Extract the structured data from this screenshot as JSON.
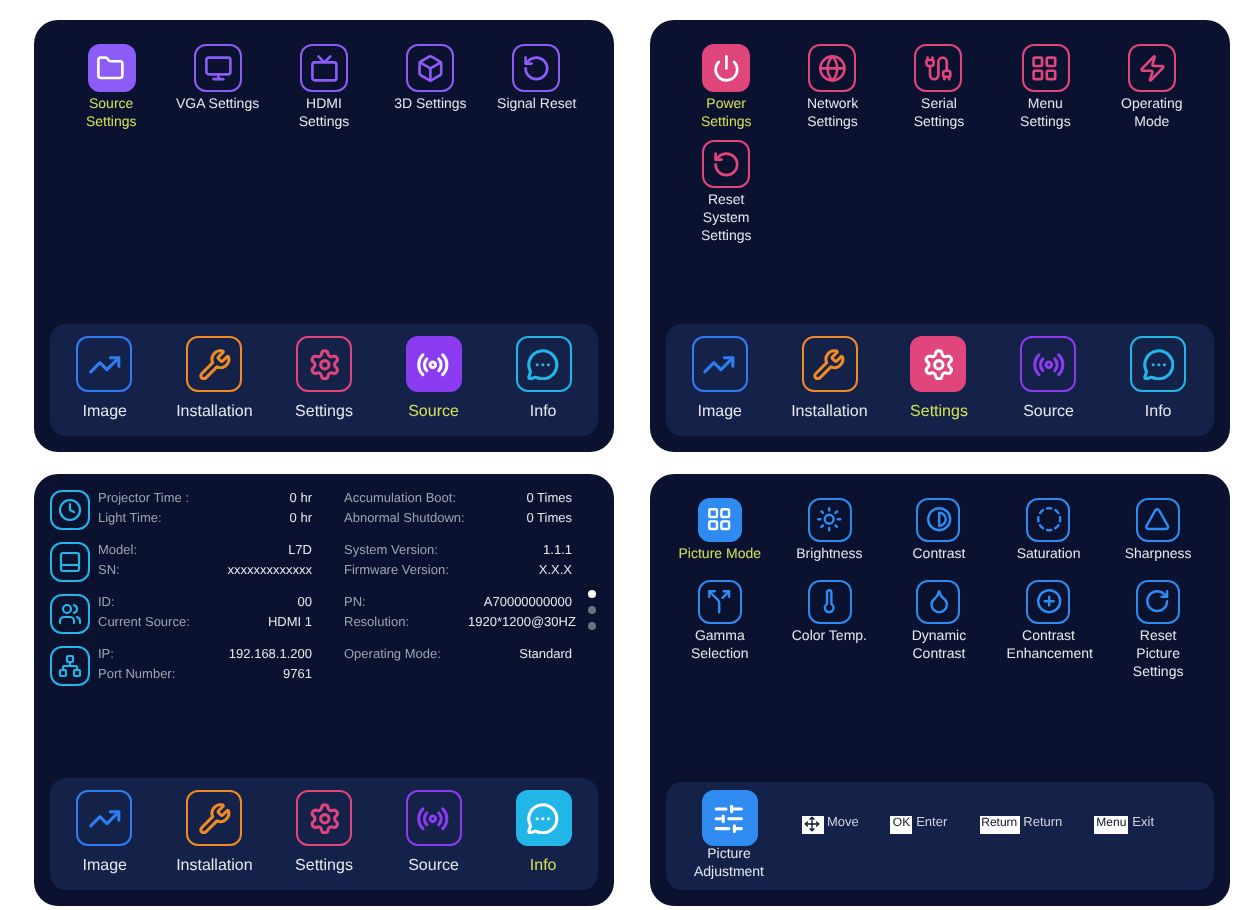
{
  "panels": [
    {
      "kind": "menu",
      "color": "#8b5cf6",
      "items": [
        {
          "label": "Source Settings",
          "selected": true
        },
        {
          "label": "VGA Settings",
          "selected": false
        },
        {
          "label": "HDMI Settings",
          "selected": false
        },
        {
          "label": "3D Settings",
          "selected": false
        },
        {
          "label": "Signal Reset",
          "selected": false
        }
      ],
      "nav": [
        {
          "label": "Image",
          "color": "#2f7df0",
          "selected": false
        },
        {
          "label": "Installation",
          "color": "#f08a24",
          "selected": false
        },
        {
          "label": "Settings",
          "color": "#e0457b",
          "selected": false
        },
        {
          "label": "Source",
          "color": "#8b3cf0",
          "selected": true
        },
        {
          "label": "Info",
          "color": "#22b5e8",
          "selected": false
        }
      ]
    },
    {
      "kind": "menu",
      "color": "#e0457b",
      "items": [
        {
          "label": "Power Settings",
          "selected": true
        },
        {
          "label": "Network Settings",
          "selected": false
        },
        {
          "label": "Serial Settings",
          "selected": false
        },
        {
          "label": "Menu Settings",
          "selected": false
        },
        {
          "label": "Operating Mode",
          "selected": false
        },
        {
          "label": "Reset System Settings",
          "selected": false
        }
      ],
      "nav": [
        {
          "label": "Image",
          "color": "#2f7df0",
          "selected": false
        },
        {
          "label": "Installation",
          "color": "#f08a24",
          "selected": false
        },
        {
          "label": "Settings",
          "color": "#e0457b",
          "selected": true
        },
        {
          "label": "Source",
          "color": "#8b3cf0",
          "selected": false
        },
        {
          "label": "Info",
          "color": "#22b5e8",
          "selected": false
        }
      ]
    },
    {
      "kind": "info",
      "groups": [
        {
          "rows": [
            [
              "Projector Time :",
              "0 hr",
              "Accumulation Boot:",
              "0 Times"
            ],
            [
              "Light Time:",
              "0 hr",
              "Abnormal Shutdown:",
              "0 Times"
            ]
          ]
        },
        {
          "rows": [
            [
              "Model:",
              "L7D",
              "System Version:",
              "1.1.1"
            ],
            [
              "SN:",
              "xxxxxxxxxxxxx",
              "Firmware Version:",
              "X.X.X"
            ]
          ]
        },
        {
          "rows": [
            [
              "ID:",
              "00",
              "PN:",
              "A70000000000"
            ],
            [
              "Current Source:",
              "HDMI 1",
              "Resolution:",
              "1920*1200@30HZ"
            ]
          ]
        },
        {
          "rows": [
            [
              "IP:",
              "192.168.1.200",
              "Operating Mode:",
              "Standard"
            ],
            [
              "Port Number:",
              "9761"
            ]
          ]
        }
      ],
      "pages": [
        {
          "selected": true
        },
        {
          "selected": false
        },
        {
          "selected": false
        }
      ],
      "nav": [
        {
          "label": "Image",
          "color": "#2f7df0",
          "selected": false
        },
        {
          "label": "Installation",
          "color": "#f08a24",
          "selected": false
        },
        {
          "label": "Settings",
          "color": "#e0457b",
          "selected": false
        },
        {
          "label": "Source",
          "color": "#8b3cf0",
          "selected": false
        },
        {
          "label": "Info",
          "color": "#22b5e8",
          "selected": true
        }
      ]
    },
    {
      "kind": "picture",
      "color": "#2f8bf0",
      "items": [
        {
          "label": "Picture Mode",
          "selected": true
        },
        {
          "label": "Brightness",
          "selected": false
        },
        {
          "label": "Contrast",
          "selected": false
        },
        {
          "label": "Saturation",
          "selected": false
        },
        {
          "label": "Sharpness",
          "selected": false
        },
        {
          "label": "Gamma Selection",
          "selected": false
        },
        {
          "label": "Color Temp.",
          "selected": false
        },
        {
          "label": "Dynamic Contrast",
          "selected": false
        },
        {
          "label": "Contrast Enhancement",
          "selected": false
        },
        {
          "label": "Reset Picture Settings",
          "selected": false
        }
      ],
      "footer": {
        "title": "Picture Adjustment",
        "hints": [
          {
            "kind": "arrows",
            "text": "Move"
          },
          {
            "kind": "key",
            "key": "OK",
            "text": "Enter"
          },
          {
            "kind": "key",
            "key": "Return",
            "text": "Return"
          },
          {
            "kind": "key",
            "key": "Menu",
            "text": "Exit"
          }
        ]
      }
    }
  ]
}
